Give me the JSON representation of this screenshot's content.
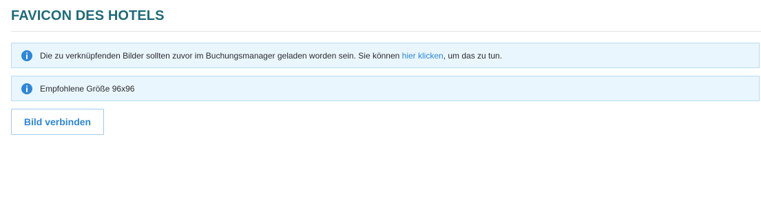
{
  "page": {
    "title": "FAVICON DES HOTELS"
  },
  "alerts": [
    {
      "icon": "info-icon",
      "text_before": "Die zu verknüpfenden Bilder sollten zuvor im Buchungsmanager geladen worden sein. Sie können ",
      "link_text": "hier klicken",
      "text_after": ", um das zu tun."
    },
    {
      "icon": "info-icon",
      "text": "Empfohlene Größe 96x96"
    }
  ],
  "actions": {
    "link_image_label": "Bild verbinden"
  },
  "colors": {
    "title": "#1f6b78",
    "info_bg": "#e9f6fe",
    "info_border": "#b7dcf3",
    "accent": "#2d86d9"
  }
}
